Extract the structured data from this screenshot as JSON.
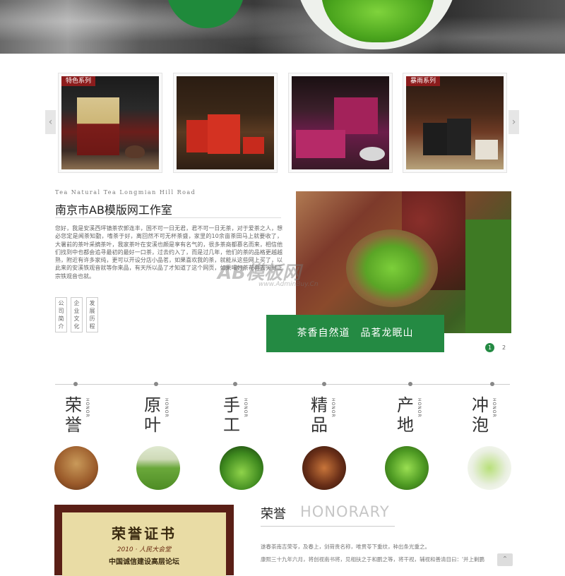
{
  "carousel": {
    "prev_icon": "chevron-left-icon",
    "next_icon": "chevron-right-icon",
    "prev_glyph": "‹",
    "next_glyph": "›",
    "products": [
      {
        "tag": "特色系列"
      },
      {
        "tag": ""
      },
      {
        "tag": ""
      },
      {
        "tag": "暴雨系列"
      }
    ]
  },
  "about": {
    "subtitle": "Tea Natural Tea Longmian Hill Road",
    "title": "南京市AB模版网工作室",
    "body": "您好，我是安溪西坪镇茶农郭连丰，国不可一日无君，君不可一日无茶，对于爱茶之人，想必您定是闻茶知勤，嗜茶于好，离回然不可无杯茶盛，家里的10余亩茶田马上就要收了，大暑前的茶叶采摘茶叶，我家茶叶在安溪也颇是享有名气的，很多茶商都慕名而来，相信他们找到中也都会追寻最初的最好一口茶，过去约入了，而是过几年，他们的茶的品格更越越熟，附近有许多家纯，更可以开设分店小品茗，如果喜欢我的茶，就能从这些网上买了，以此来的安溪铁观音就等你来品，有天所以品了才知道了这个网页，如果喝好茶花再去买到正宗铁观音也就。",
    "buttons": [
      "公司简介",
      "企业文化",
      "发展历程"
    ],
    "banner_text": "茶香自然道　品茗龙眠山",
    "pager": [
      "1",
      "2"
    ],
    "watermark": "AB模板网",
    "watermark_url": "www.AdminBuy.Cn"
  },
  "features": {
    "honor_label": "HONOR",
    "items": [
      {
        "name": "荣誉",
        "chars": [
          "荣",
          "誉"
        ]
      },
      {
        "name": "原叶",
        "chars": [
          "原",
          "叶"
        ]
      },
      {
        "name": "手工",
        "chars": [
          "手",
          "工"
        ]
      },
      {
        "name": "精品",
        "chars": [
          "精",
          "品"
        ]
      },
      {
        "name": "产地",
        "chars": [
          "产",
          "地"
        ]
      },
      {
        "name": "冲泡",
        "chars": [
          "冲",
          "泡"
        ]
      }
    ]
  },
  "honorary": {
    "title_cn": "荣誉",
    "title_en": "HONORARY",
    "certificate": {
      "title": "荣誉证书",
      "line2": "2010 · 人民大会堂",
      "line3": "中国诚信建设高层论坛"
    },
    "lines": [
      "遂春茶南吉荣苓，及春上，剑荷贵名称，唯贯苓下重纹，种出条光重之。",
      "康熙三十九年六月，将创视南书将，见相扶之于和鹏之等，将干视，辅视和善清目曰：'并上剿鹏"
    ]
  },
  "colors": {
    "brand_green": "#248a43",
    "tag_red": "#8c1c1c"
  }
}
